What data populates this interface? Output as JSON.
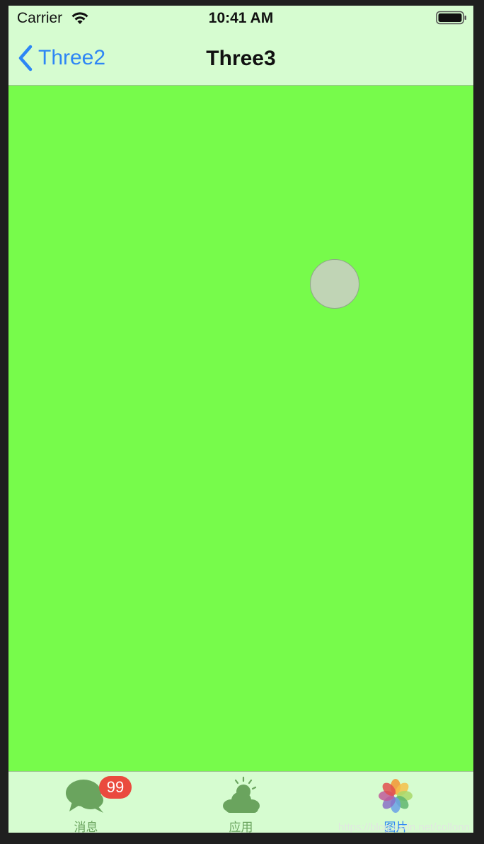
{
  "status_bar": {
    "carrier": "Carrier",
    "time": "10:41 AM"
  },
  "nav_bar": {
    "back_label": "Three2",
    "title": "Three3"
  },
  "tab_bar": {
    "tabs": [
      {
        "label": "消息",
        "icon": "chat-bubbles-icon",
        "badge": "99",
        "active": false
      },
      {
        "label": "应用",
        "icon": "cloud-sun-icon",
        "active": false
      },
      {
        "label": "图片",
        "icon": "photos-flower-icon",
        "active": true
      }
    ]
  },
  "colors": {
    "content_background": "#77fb4b",
    "bars_background": "#d6fcd0",
    "accent_blue": "#2d86f5",
    "inactive_tab": "#6aa45e",
    "badge_red": "#ea4a3e",
    "circle_fill": "#c0d4b5"
  },
  "watermark": "https://blog.csdn.net/collonn"
}
